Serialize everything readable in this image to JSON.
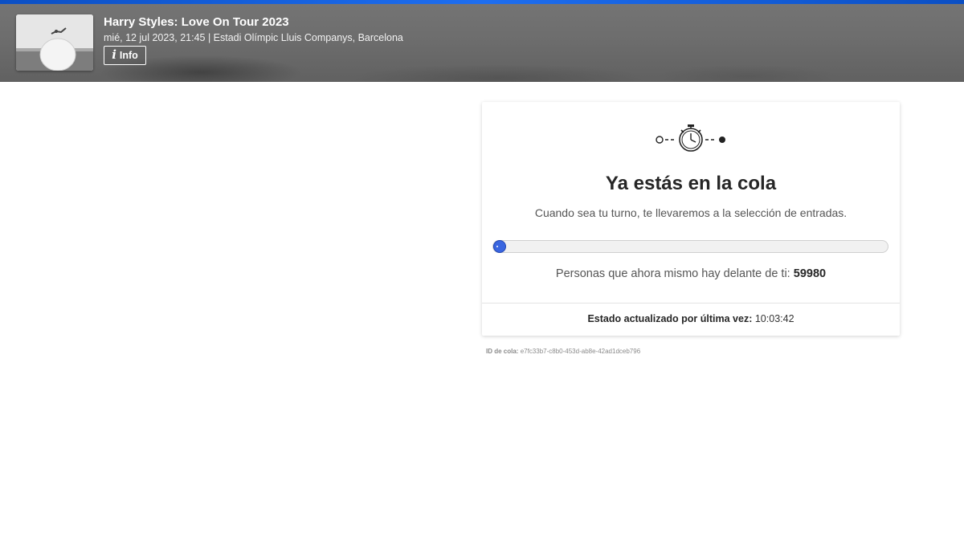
{
  "colors": {
    "accent_bar": "#0b4fc4",
    "header_background": "#6d6d6d",
    "progress_fill": "#2f5fd6",
    "card_background": "#ffffff"
  },
  "header": {
    "event_title": "Harry Styles: Love On Tour 2023",
    "event_meta": "mié, 12 jul 2023, 21:45 | Estadi Olímpic Lluis Companys, Barcelona",
    "info_button": {
      "icon": "info-icon",
      "label": "Info"
    },
    "thumbnail": {
      "icon": "event-photo"
    }
  },
  "queue": {
    "icon": "stopwatch-icon",
    "title": "Ya estás en la cola",
    "subtitle": "Cuando sea tu turno, te llevaremos a la selección de entradas.",
    "progress_fraction": 0.01,
    "ahead_label": "Personas que ahora mismo hay delante de ti:",
    "ahead_count": "59980",
    "updated_label": "Estado actualizado por última vez:",
    "updated_time": "10:03:42",
    "queue_id_label": "ID de cola:",
    "queue_id": "e7fc33b7-c8b0-453d-ab8e-42ad1dceb796"
  }
}
